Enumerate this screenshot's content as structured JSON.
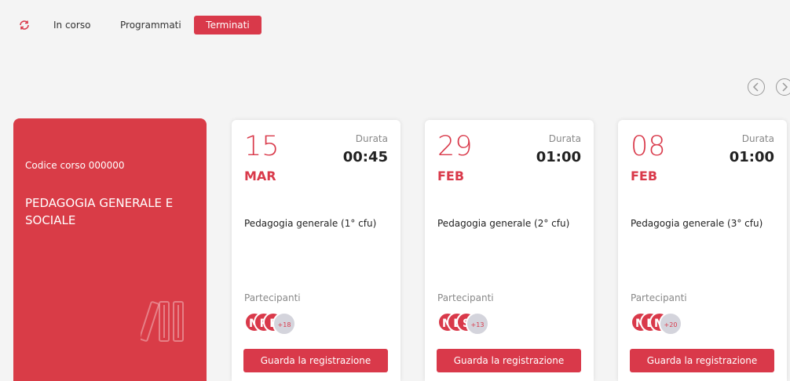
{
  "tabs": {
    "in_corso": "In corso",
    "programmati": "Programmati",
    "terminati": "Terminati"
  },
  "course": {
    "code": "Codice corso 000000",
    "title": "PEDAGOGIA GENERALE E SOCIALE"
  },
  "colors": {
    "accent": "#d9394a",
    "course_card": "#d93c47",
    "avatar_more_bg": "#d4d4dc"
  },
  "lessons": [
    {
      "day": "15",
      "month": "MAR",
      "duration_label": "Durata",
      "duration": "00:45",
      "title": "Pedagogia generale (1° cfu)",
      "participants_label": "Partecipanti",
      "avatars": [
        "M",
        "R",
        "E"
      ],
      "more": "+18",
      "button": "Guarda la registrazione"
    },
    {
      "day": "29",
      "month": "FEB",
      "duration_label": "Durata",
      "duration": "01:00",
      "title": "Pedagogia generale (2° cfu)",
      "participants_label": "Partecipanti",
      "avatars": [
        "M",
        "E",
        "S"
      ],
      "more": "+13",
      "button": "Guarda la registrazione"
    },
    {
      "day": "08",
      "month": "FEB",
      "duration_label": "Durata",
      "duration": "01:00",
      "title": "Pedagogia generale (3° cfu)",
      "participants_label": "Partecipanti",
      "avatars": [
        "M",
        "E",
        "M"
      ],
      "more": "+20",
      "button": "Guarda la registrazione"
    }
  ]
}
